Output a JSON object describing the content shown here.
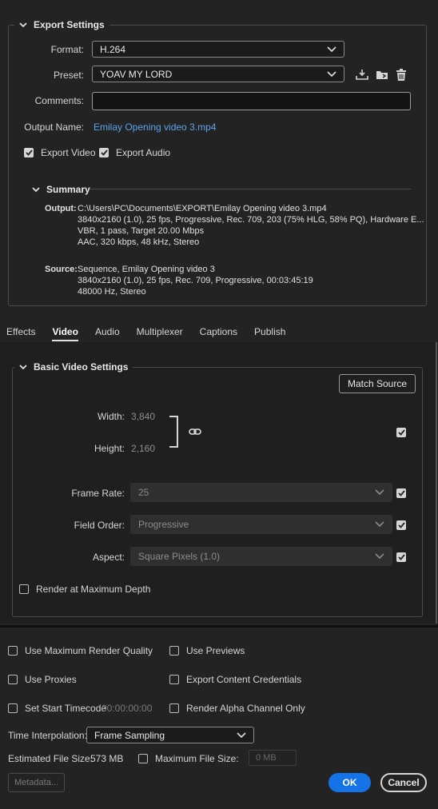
{
  "export_settings": {
    "title": "Export Settings",
    "format_label": "Format:",
    "format_value": "H.264",
    "preset_label": "Preset:",
    "preset_value": "YOAV MY LORD",
    "comments_label": "Comments:",
    "comments_value": "",
    "output_name_label": "Output Name:",
    "output_name_value": "Emilay Opening video 3.mp4",
    "export_video_label": "Export Video",
    "export_video_checked": true,
    "export_audio_label": "Export Audio",
    "export_audio_checked": true,
    "summary": {
      "title": "Summary",
      "output_label": "Output:",
      "output_lines": [
        "C:\\Users\\PC\\Documents\\EXPORT\\Emilay Opening video 3.mp4",
        "3840x2160 (1.0), 25 fps, Progressive, Rec. 709, 203 (75% HLG, 58% PQ), Hardware E...",
        "VBR, 1 pass, Target 20.00 Mbps",
        "AAC, 320 kbps, 48 kHz, Stereo"
      ],
      "source_label": "Source:",
      "source_lines": [
        "Sequence, Emilay Opening video 3",
        "3840x2160 (1.0), 25 fps, Rec. 709, Progressive, 00:03:45:19",
        "48000 Hz, Stereo"
      ]
    }
  },
  "tabs": [
    "Effects",
    "Video",
    "Audio",
    "Multiplexer",
    "Captions",
    "Publish"
  ],
  "active_tab": "Video",
  "basic_video": {
    "title": "Basic Video Settings",
    "match_source": "Match Source",
    "width_label": "Width:",
    "width_value": "3,840",
    "height_label": "Height:",
    "height_value": "2,160",
    "frame_rate_label": "Frame Rate:",
    "frame_rate_value": "25",
    "field_order_label": "Field Order:",
    "field_order_value": "Progressive",
    "aspect_label": "Aspect:",
    "aspect_value": "Square Pixels (1.0)",
    "render_max_depth_label": "Render at Maximum Depth"
  },
  "bottom": {
    "use_max_render_quality": "Use Maximum Render Quality",
    "use_previews": "Use Previews",
    "use_proxies": "Use Proxies",
    "export_content_credentials": "Export Content Credentials",
    "set_start_timecode": "Set Start Timecode",
    "start_timecode_value": "00:00:00:00",
    "render_alpha_only": "Render Alpha Channel Only",
    "time_interpolation_label": "Time Interpolation:",
    "time_interpolation_value": "Frame Sampling",
    "estimated_file_size_label": "Estimated File Size:",
    "estimated_file_size_value": "573 MB",
    "maximum_file_size_label": "Maximum File Size:",
    "maximum_file_size_placeholder": "0 MB",
    "metadata_button": "Metadata...",
    "ok_button": "OK",
    "cancel_button": "Cancel"
  },
  "colors": {
    "accent": "#1473e6",
    "link": "#5aa4ec",
    "background": "#232323"
  }
}
